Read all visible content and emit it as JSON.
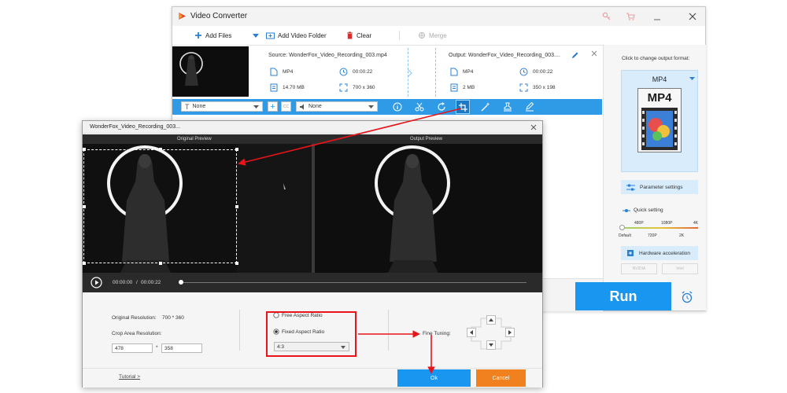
{
  "main_window": {
    "title": "Video Converter",
    "toolbar": {
      "add_files": "Add Files",
      "add_video_folder": "Add Video Folder",
      "clear": "Clear",
      "merge": "Merge"
    },
    "file": {
      "source_label": "Source: WonderFox_Video_Recording_003.mp4",
      "source_format": "MP4",
      "source_duration": "00:00:22",
      "source_size": "14.70 MB",
      "source_resolution": "700 x 360",
      "output_label": "Output: WonderFox_Video_Recording_003....",
      "output_format": "MP4",
      "output_duration": "00:00:22",
      "output_size": "2 MB",
      "output_resolution": "350 x 198"
    },
    "edit_bar": {
      "subtitle_value": "None",
      "audio_value": "None"
    },
    "right_panel": {
      "change_format_label": "Click to change output format:",
      "format_value": "MP4",
      "format_icon_text": "MP4",
      "parameter_settings": "Parameter settings",
      "quick_setting": "Quick setting",
      "quality_top": [
        "480P",
        "1080P",
        "4K"
      ],
      "quality_bottom": [
        "Default",
        "720P",
        "2K"
      ],
      "hardware_acceleration": "Hardware acceleration",
      "nvidia": "NVIDIA",
      "intel": "Intel"
    },
    "run_label": "Run"
  },
  "dialog": {
    "title": "WonderFox_Video_Recording_003...",
    "original_preview": "Original Preview",
    "output_preview": "Output Preview",
    "time_current": "00:00:00",
    "time_separator": "/",
    "time_total": "00:00:22",
    "original_resolution_label": "Original Resolution:",
    "original_resolution_value": "700 * 360",
    "crop_area_label": "Crop Area Resolution:",
    "crop_width": "478",
    "crop_times": "*",
    "crop_height": "358",
    "free_aspect": "Free Aspect Ratio",
    "fixed_aspect": "Fixed Aspect Ratio",
    "aspect_value": "4:3",
    "fine_tuning": "Fine Tuning:",
    "tutorial": "Tutorial >",
    "ok": "Ok",
    "cancel": "Cancel"
  },
  "colors": {
    "accent_blue": "#2f9be6",
    "run_blue": "#1996ef",
    "cancel_orange": "#f0811e",
    "annotation_red": "#e8141a"
  }
}
